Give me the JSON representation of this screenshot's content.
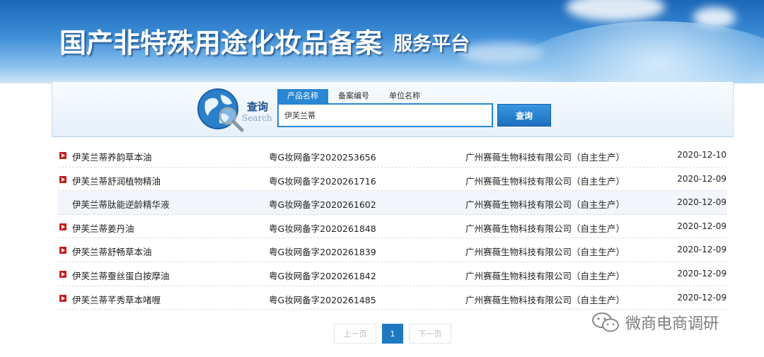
{
  "banner": {
    "title": "国产非特殊用途化妆品备案",
    "subtitle": "服务平台"
  },
  "search": {
    "logo_label": "查询",
    "logo_label_en": "Search",
    "tabs": [
      {
        "label": "产品名称",
        "active": true
      },
      {
        "label": "备案编号",
        "active": false
      },
      {
        "label": "单位名称",
        "active": false
      }
    ],
    "query": "伊芙兰蒂",
    "button_label": "查询"
  },
  "results": [
    {
      "name": "伊芙兰蒂养韵草本油",
      "reg_no": "粤G妆网备字2020253656",
      "company": "广州赛薇生物科技有限公司（自主生产）",
      "date": "2020-12-10",
      "bullet": true
    },
    {
      "name": "伊芙兰蒂舒润植物精油",
      "reg_no": "粤G妆网备字2020261716",
      "company": "广州赛薇生物科技有限公司（自主生产）",
      "date": "2020-12-09",
      "bullet": true
    },
    {
      "name": "伊芙兰蒂肽能逆龄精华液",
      "reg_no": "粤G妆网备字2020261602",
      "company": "广州赛薇生物科技有限公司（自主生产）",
      "date": "2020-12-09",
      "bullet": false
    },
    {
      "name": "伊芙兰蒂姜丹油",
      "reg_no": "粤G妆网备字2020261848",
      "company": "广州赛薇生物科技有限公司（自主生产）",
      "date": "2020-12-09",
      "bullet": true
    },
    {
      "name": "伊芙兰蒂舒畅草本油",
      "reg_no": "粤G妆网备字2020261839",
      "company": "广州赛薇生物科技有限公司（自主生产）",
      "date": "2020-12-09",
      "bullet": true
    },
    {
      "name": "伊芙兰蒂蚕丝蛋白按摩油",
      "reg_no": "粤G妆网备字2020261842",
      "company": "广州赛薇生物科技有限公司（自主生产）",
      "date": "2020-12-09",
      "bullet": true
    },
    {
      "name": "伊芙兰蒂芊秀草本啫喱",
      "reg_no": "粤G妆网备字2020261485",
      "company": "广州赛薇生物科技有限公司（自主生产）",
      "date": "2020-12-09",
      "bullet": true
    }
  ],
  "pager": {
    "prev_label": "上一页",
    "current_page": "1",
    "next_label": "下一页"
  },
  "watermark": {
    "text": "微商电商调研",
    "icon": "wechat-icon"
  },
  "colors": {
    "accent": "#2a86d2",
    "bullet": "#c71d1d",
    "banner_top": "#1b67b8"
  }
}
